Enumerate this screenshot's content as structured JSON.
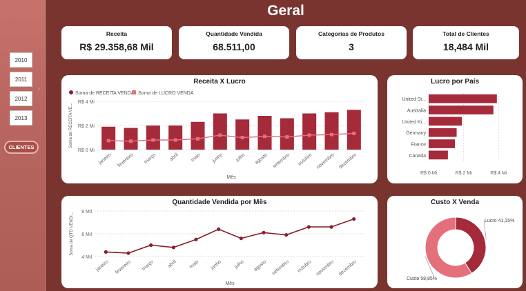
{
  "sidebar": {
    "years": [
      "2010",
      "2011",
      "2012",
      "2013"
    ],
    "clientes_label": "CLIENTES",
    "arrow": "›"
  },
  "page_title": "Geral",
  "kpis": [
    {
      "label": "Receita",
      "value": "R$ 29.358,68 Mil"
    },
    {
      "label": "Quantidade Vendida",
      "value": "68.511,00"
    },
    {
      "label": "Categorias de Produtos",
      "value": "3"
    },
    {
      "label": "Total de Clientes",
      "value": "18,484 Mil"
    }
  ],
  "colors": {
    "bar": "#a52a3a",
    "line": "#e4707c",
    "accent": "#8b1e2d",
    "pie_light": "#e4707c"
  },
  "chart_data": [
    {
      "type": "bar",
      "title": "Receita X Lucro",
      "xlabel": "Mês",
      "ylabel": "Soma de RECEITA VE...",
      "yticks": [
        "R$ 0 Mi",
        "R$ 2 Mi",
        "R$ 4 Mi"
      ],
      "ylim": [
        0,
        4
      ],
      "legend": [
        "Soma de RECEITA VENDA",
        "Soma de LUCRO VENDA"
      ],
      "categories": [
        "janeiro",
        "fevereiro",
        "março",
        "abril",
        "maio",
        "junho",
        "julho",
        "agosto",
        "setembro",
        "outubro",
        "novembro",
        "dezembro"
      ],
      "series": [
        {
          "name": "Soma de RECEITA VENDA",
          "values": [
            1.9,
            1.8,
            2.0,
            2.0,
            2.3,
            3.0,
            2.5,
            2.8,
            2.6,
            3.0,
            3.1,
            3.3
          ]
        },
        {
          "name": "Soma de LUCRO VENDA",
          "values": [
            0.75,
            0.7,
            0.8,
            0.8,
            0.9,
            1.2,
            1.0,
            1.1,
            1.05,
            1.2,
            1.25,
            1.35
          ]
        }
      ]
    },
    {
      "type": "bar",
      "title": "Lucro por País",
      "orientation": "horizontal",
      "categories": [
        "United St...",
        "Australia",
        "United Ki...",
        "Germany",
        "France",
        "Canada"
      ],
      "values": [
        3.9,
        3.7,
        1.9,
        1.6,
        1.5,
        1.1
      ],
      "xticks": [
        "R$ 0 Mi",
        "R$ 2 Mi",
        "R$ 4 Mi"
      ],
      "xlim": [
        0,
        4.5
      ]
    },
    {
      "type": "line",
      "title": "Quantidade Vendida por Mês",
      "xlabel": "Mês",
      "ylabel": "Soma de QTD VENDI...",
      "yticks": [
        "4 Mil",
        "6 Mil",
        "8 Mil"
      ],
      "ylim": [
        4,
        8
      ],
      "categories": [
        "janeiro",
        "fevereiro",
        "março",
        "abril",
        "maio",
        "junho",
        "julho",
        "agosto",
        "setembro",
        "outubro",
        "novembro",
        "dezembro"
      ],
      "values": [
        4.4,
        4.3,
        5.0,
        4.8,
        5.5,
        6.4,
        5.6,
        6.1,
        5.9,
        6.6,
        6.6,
        7.3
      ]
    },
    {
      "type": "pie",
      "title": "Custo X Venda",
      "slices": [
        {
          "label": "Lucro 41,15%",
          "value": 41.15
        },
        {
          "label": "Custo 58,85%",
          "value": 58.85
        }
      ]
    }
  ]
}
